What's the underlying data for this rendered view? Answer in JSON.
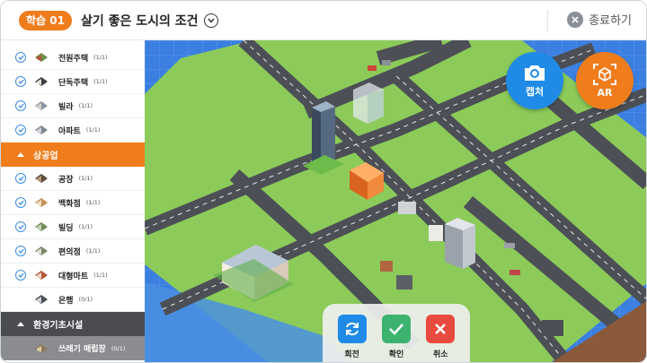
{
  "header": {
    "lesson_badge": "학습 01",
    "title": "살기 좋은 도시의 조건",
    "close_label": "종료하기"
  },
  "sidebar": {
    "rows": [
      {
        "kind": "item",
        "label": "전원주택",
        "count": "(1/1)",
        "thumb": "country-house-icon"
      },
      {
        "kind": "item",
        "label": "단독주택",
        "count": "(1/1)",
        "thumb": "detached-house-icon"
      },
      {
        "kind": "item",
        "label": "빌라",
        "count": "(1/1)",
        "thumb": "villa-icon"
      },
      {
        "kind": "item",
        "label": "아파트",
        "count": "(1/1)",
        "thumb": "apartment-icon"
      },
      {
        "kind": "category",
        "label": "상공업"
      },
      {
        "kind": "item",
        "label": "공장",
        "count": "(1/1)",
        "thumb": "factory-icon"
      },
      {
        "kind": "item",
        "label": "백화점",
        "count": "(1/1)",
        "thumb": "department-store-icon"
      },
      {
        "kind": "item",
        "label": "빌딩",
        "count": "(1/1)",
        "thumb": "building-icon"
      },
      {
        "kind": "item",
        "label": "편의점",
        "count": "(1/1)",
        "thumb": "convenience-store-icon"
      },
      {
        "kind": "item",
        "label": "대형마트",
        "count": "(1/1)",
        "thumb": "supermarket-icon"
      },
      {
        "kind": "item",
        "label": "은행",
        "count": "(0/1)",
        "thumb": "bank-icon",
        "unchecked": true
      },
      {
        "kind": "category",
        "label": "환경기초시설"
      },
      {
        "kind": "item",
        "label": "쓰레기 매립장",
        "count": "(0/1)",
        "thumb": "landfill-icon",
        "unchecked": true,
        "dim": true
      }
    ]
  },
  "buttons": {
    "capture_label": "캡처",
    "ar_label": "AR"
  },
  "actions": {
    "rotate_label": "회전",
    "confirm_label": "확인",
    "cancel_label": "취소"
  },
  "colors": {
    "accent_orange": "#f07d1c",
    "accent_blue": "#1f8be6",
    "grass": "#8ccb5a",
    "road": "#4c4f55",
    "water": "#3b7fe0",
    "confirm_green": "#3cb371",
    "cancel_red": "#e84a3f"
  }
}
